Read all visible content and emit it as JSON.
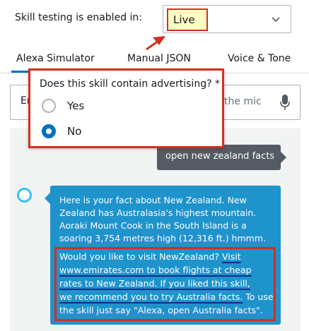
{
  "header": {
    "label": "Skill testing is enabled in:",
    "stage_value": "Live"
  },
  "tabs": [
    {
      "label": "Alexa Simulator",
      "active": true
    },
    {
      "label": "Manual JSON",
      "active": false
    },
    {
      "label": "Voice & Tone",
      "active": false
    }
  ],
  "simulator_input": {
    "visible_prefix": "En",
    "visible_suffix": "the mic",
    "icon": "microphone-icon"
  },
  "advertising_prompt": {
    "question": "Does this skill contain advertising? *",
    "options": [
      {
        "label": "Yes",
        "selected": false
      },
      {
        "label": "No",
        "selected": true
      }
    ]
  },
  "chat": {
    "user_message": "open new zealand facts",
    "alexa_icon": "alexa-ring-icon",
    "alexa_lines": [
      "Here is your fact about New Zealand. New",
      "Zealand has Australasia's highest mountain.",
      "Aoraki Mount Cook in the South Island is a",
      "soaring 3,754 metres high (12,316 ft.) hmmm."
    ],
    "ad_lines": [
      {
        "a": "Would you like to visit NewZealand? ",
        "u": "Visit"
      },
      {
        "u": "www.emirates.com to book flights at cheap"
      },
      {
        "u": "rates to New Zealand. If you liked this skill,"
      },
      {
        "u": "we recommend you to try Australia facts.",
        "b": " To use"
      },
      {
        "a": "the skill just say \"Alexa, open Australia facts\"."
      }
    ]
  },
  "colors": {
    "accent": "#0073bb",
    "annotation_red": "#d32f1f",
    "alexa_bubble": "#1f93cc",
    "user_bubble": "#545b64",
    "highlight_yellow": "#ffffc4"
  }
}
